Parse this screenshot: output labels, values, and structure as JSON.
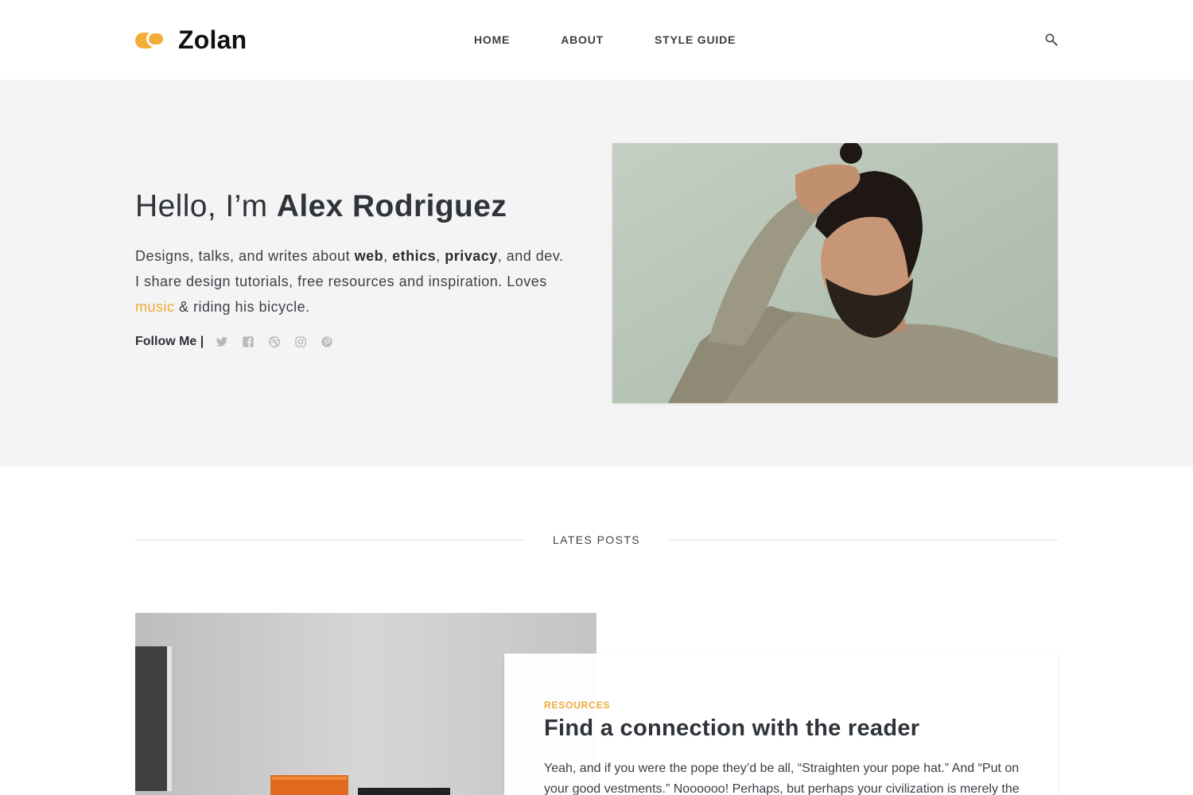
{
  "brand": {
    "name": "Zolan",
    "logo_icon": "overlapping-circles-logo",
    "accent": "#f5ad3a"
  },
  "nav": {
    "items": [
      {
        "label": "HOME"
      },
      {
        "label": "ABOUT"
      },
      {
        "label": "STYLE GUIDE"
      }
    ],
    "search_icon": "search-icon"
  },
  "hero": {
    "greeting": "Hello, I’m ",
    "name": "Alex Rodriguez",
    "desc": {
      "t1": "Designs, talks, and writes about ",
      "b1": "web",
      "t2": ", ",
      "b2": "ethics",
      "t3": ", ",
      "b3": "privacy",
      "t4": ", and dev. I share design tutorials, free resources and inspiration. Loves ",
      "link": "music",
      "t5": " & riding his bicycle."
    },
    "follow_label": "Follow Me |",
    "social": [
      "twitter-icon",
      "facebook-icon",
      "dribbble-icon",
      "instagram-icon",
      "pinterest-icon"
    ],
    "photo": "portrait-photo"
  },
  "latest": {
    "heading": "LATES POSTS"
  },
  "post": {
    "category": "RESOURCES",
    "title": "Find a connection with the reader",
    "excerpt": "Yeah, and if you were the pope they’d be all, “Straighten your pope hat.” And “Put on your good vestments.” Noooooo! Perhaps, but perhaps your civilization is merely the",
    "image": "post-cover-photo"
  },
  "colors": {
    "hero_bg": "#f4f4f4",
    "link": "#f0a837",
    "text": "#333740"
  }
}
